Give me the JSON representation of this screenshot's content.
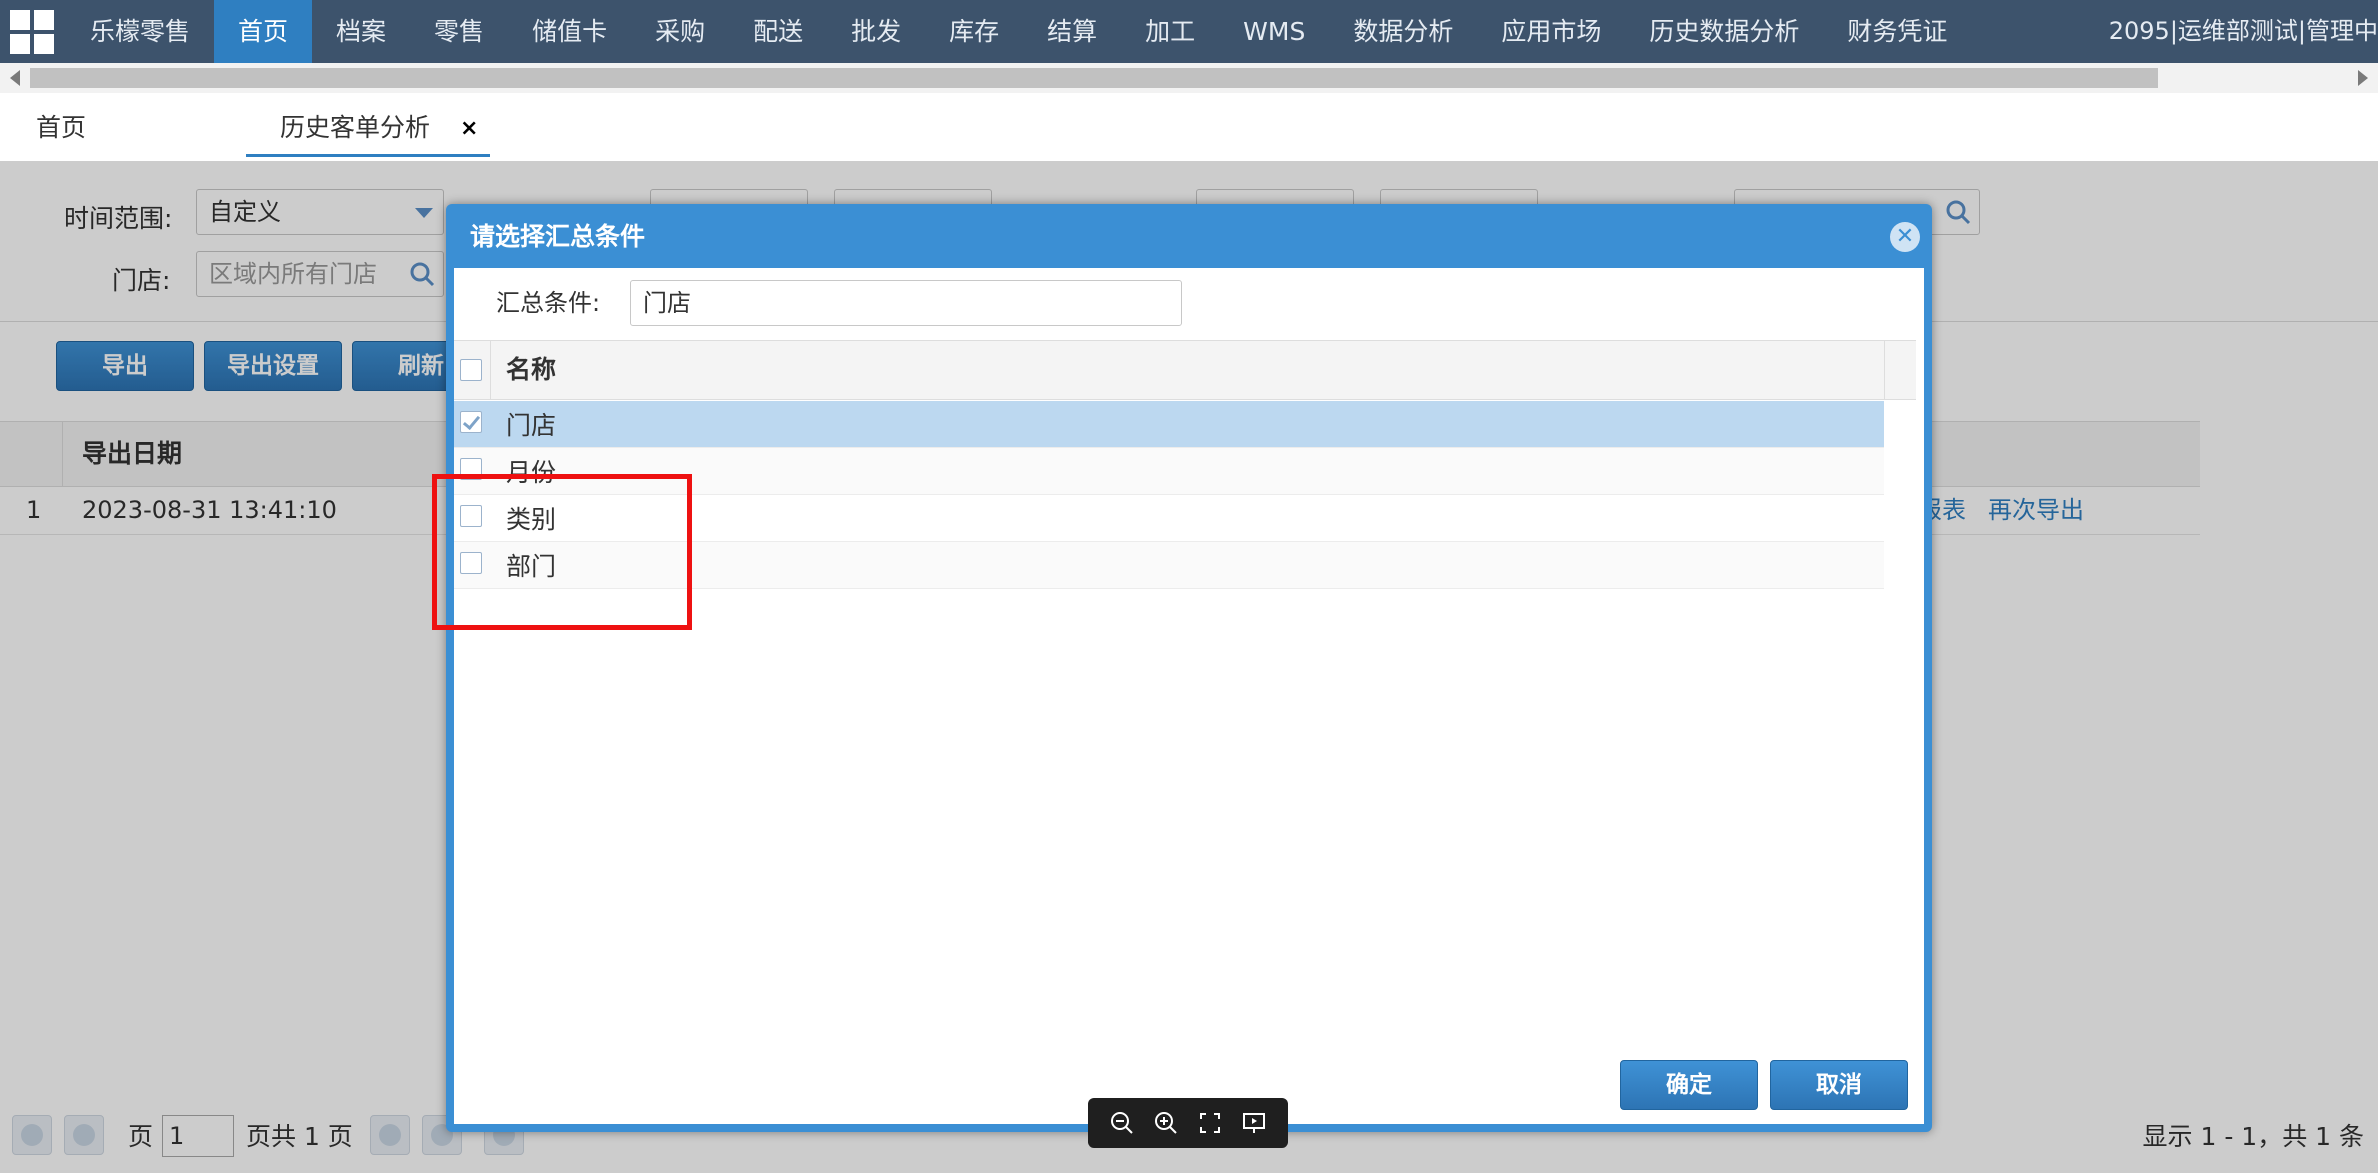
{
  "topnav": {
    "brand": "乐檬零售",
    "items": [
      "首页",
      "档案",
      "零售",
      "储值卡",
      "采购",
      "配送",
      "批发",
      "库存",
      "结算",
      "加工",
      "WMS",
      "数据分析",
      "应用市场",
      "历史数据分析",
      "财务凭证"
    ],
    "active_index": 0,
    "user": "2095|运维部测试|管理中"
  },
  "tabs": {
    "home": "首页",
    "history": "历史客单分析",
    "close_glyph": "×"
  },
  "filters": {
    "time_range_label": "时间范围:",
    "time_range_value": "自定义",
    "store_label": "门店:",
    "store_placeholder": "区域内所有门店"
  },
  "toolbar": {
    "export": "导出",
    "export_settings": "导出设置",
    "refresh": "刷新"
  },
  "grid": {
    "col_export_date": "导出日期",
    "rows": [
      {
        "index": "1",
        "export_date": "2023-08-31 13:41:10",
        "action_view": "报表",
        "action_reexport": "再次导出"
      }
    ]
  },
  "pager": {
    "page_label": "页",
    "page_value": "1",
    "total_pages": "页共 1 页",
    "summary": "显示 1 - 1，共 1 条"
  },
  "dialog": {
    "title": "请选择汇总条件",
    "cond_label": "汇总条件:",
    "cond_value": "门店",
    "col_name": "名称",
    "options": [
      {
        "label": "门店",
        "checked": true
      },
      {
        "label": "月份",
        "checked": false
      },
      {
        "label": "类别",
        "checked": false
      },
      {
        "label": "部门",
        "checked": false
      }
    ],
    "confirm": "确定",
    "cancel": "取消"
  },
  "colors": {
    "nav_bg": "#3d536c",
    "nav_active": "#2f7fc1",
    "dialog_blue": "#3b8fd4",
    "selected_row": "#bcd8f0",
    "highlight": "#ee1111"
  },
  "icons": {
    "apps": "grid-apps-icon",
    "close": "close-icon",
    "search": "search-icon",
    "zoom_out": "zoom-out-icon",
    "zoom_in": "zoom-in-icon",
    "fit": "fit-screen-icon",
    "slideshow": "slideshow-icon"
  }
}
